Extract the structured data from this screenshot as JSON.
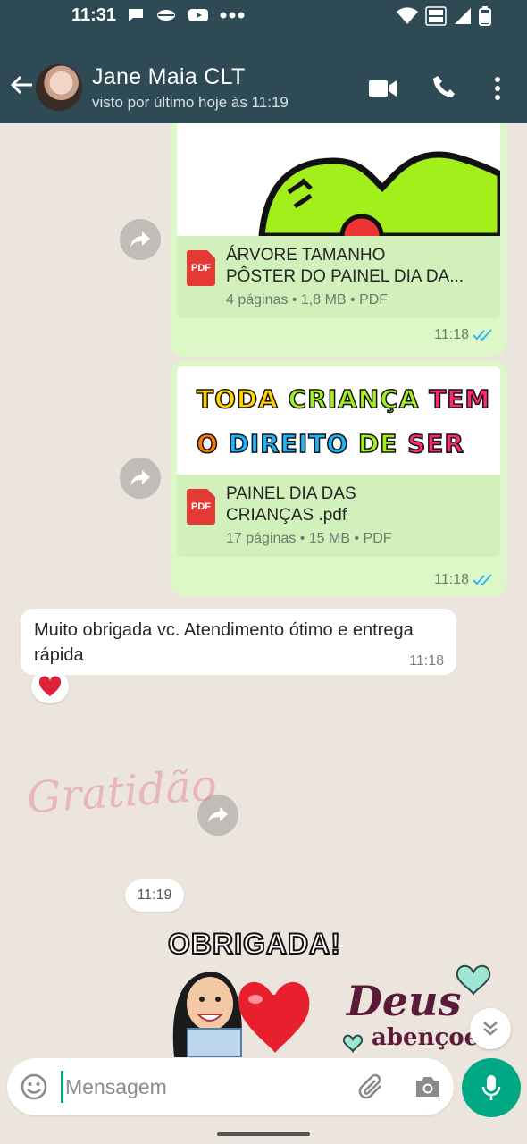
{
  "status_bar": {
    "time": "11:31"
  },
  "header": {
    "contact_name": "Jane Maia CLT",
    "last_seen": "visto por último hoje às 11:19",
    "colors": {
      "bar": "#2e4a55"
    }
  },
  "messages": {
    "doc1": {
      "name_line1": "ÁRVORE TAMANHO",
      "name_line2": "PÔSTER DO PAINEL DIA DA...",
      "meta": "4 páginas • 1,8 MB • PDF",
      "time": "11:18",
      "icon_label": "PDF"
    },
    "doc2": {
      "preview_line1": [
        "TODA",
        "CRIANÇA",
        "TEM"
      ],
      "preview_line2": [
        "O",
        "DIREITO",
        "DE",
        "SER"
      ],
      "name_line1": "PAINEL DIA DAS",
      "name_line2": "CRIANÇAS .pdf",
      "meta": "17 páginas • 15 MB • PDF",
      "time": "11:18",
      "icon_label": "PDF"
    },
    "incoming": {
      "text": "Muito obrigada vc. Atendimento ótimo e entrega rápida",
      "time": "11:18"
    },
    "sticker_gratidao": {
      "text": "Gratidão"
    },
    "time_pill": "11:19",
    "sticker_obrigada": {
      "text": "OBRIGADA!"
    },
    "sticker_deus": {
      "line1": "Deus",
      "line2": "abençoe"
    }
  },
  "composer": {
    "placeholder": "Mensagem"
  },
  "colors": {
    "accent": "#00a884",
    "outgoing_bubble": "#dcf8c6",
    "chat_bg": "#ece5dd",
    "read_ticks": "#34b7f1"
  }
}
